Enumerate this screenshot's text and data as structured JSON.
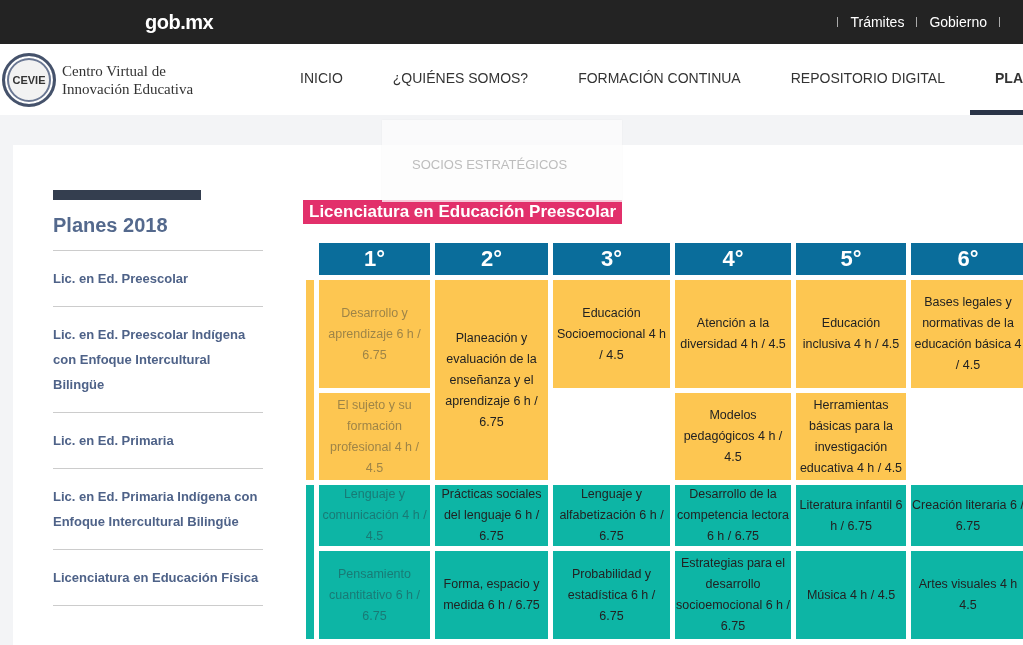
{
  "top_bar": {
    "brand": "gob.mx",
    "links": [
      "Trámites",
      "Gobierno"
    ]
  },
  "header": {
    "logo_badge": "CEVIE",
    "logo_lines": [
      "Centro Virtual de",
      "Innovación Educativa"
    ],
    "nav": [
      {
        "label": "INICIO",
        "selected": false
      },
      {
        "label": "¿QUIÉNES SOMOS?",
        "selected": false
      },
      {
        "label": "FORMACIÓN CONTINUA",
        "selected": false
      },
      {
        "label": "REPOSITORIO DIGITAL",
        "selected": false
      },
      {
        "label": "PLA",
        "selected": true
      }
    ],
    "dropdown": [
      "SOCIOS ESTRATÉGICOS"
    ]
  },
  "sidebar": {
    "title": "Planes 2018",
    "items": [
      "Lic. en Ed. Preescolar",
      "Lic. en Ed. Preescolar Indígena con Enfoque Intercultural Bilingüe",
      "Lic. en Ed. Primaria",
      "Lic. en Ed. Primaria Indígena con Enfoque Intercultural Bilingüe",
      "Licenciatura en Educación Física"
    ]
  },
  "plan": {
    "title": "Licenciatura en Educación Preescolar",
    "columns": [
      "1°",
      "2°",
      "3°",
      "4°",
      "5°",
      "6°"
    ],
    "groups": [
      {
        "color": "#fdc651",
        "rows": [
          [
            {
              "kind": "course",
              "text": "Desarrollo y aprendizaje 6 h / 6.75",
              "faded": true,
              "tall": false
            },
            {
              "kind": "course",
              "text": "Planeación y evaluación de la enseñanza y el aprendizaje 6 h / 6.75",
              "faded": false,
              "tall": true
            },
            {
              "kind": "course",
              "text": "Educación Socioemocional 4 h / 4.5",
              "faded": false,
              "tall": false
            },
            {
              "kind": "course",
              "text": "Atención a la diversidad 4 h / 4.5",
              "faded": false,
              "tall": false
            },
            {
              "kind": "course",
              "text": "Educación inclusiva 4 h / 4.5",
              "faded": false,
              "tall": false
            },
            {
              "kind": "course",
              "text": "Bases legales y normativas de la educación básica 4 / 4.5",
              "faded": false,
              "tall": false
            }
          ],
          [
            {
              "kind": "course",
              "text": "El sujeto y su formación profesional 4 h / 4.5",
              "faded": true,
              "tall": false
            },
            {
              "kind": "covered"
            },
            {
              "kind": "empty"
            },
            {
              "kind": "course",
              "text": "Modelos pedagógicos 4 h / 4.5",
              "faded": false,
              "tall": false
            },
            {
              "kind": "course",
              "text": "Herramientas básicas para la investigación educativa 4 h / 4.5",
              "faded": false,
              "tall": false
            },
            {
              "kind": "empty"
            }
          ]
        ]
      },
      {
        "color": "#0db5a5",
        "rows": [
          [
            {
              "kind": "course",
              "text": "Lenguaje y comunicación 4 h / 4.5",
              "faded": true,
              "tall": false
            },
            {
              "kind": "course",
              "text": "Prácticas sociales del lenguaje 6 h / 6.75",
              "faded": false,
              "tall": false
            },
            {
              "kind": "course",
              "text": "Lenguaje y alfabetización 6 h / 6.75",
              "faded": false,
              "tall": false
            },
            {
              "kind": "course",
              "text": "Desarrollo de la competencia lectora 6 h / 6.75",
              "faded": false,
              "tall": false
            },
            {
              "kind": "course",
              "text": "Literatura infantil 6 h / 6.75",
              "faded": false,
              "tall": false
            },
            {
              "kind": "course",
              "text": "Creación literaria 6 / 6.75",
              "faded": false,
              "tall": false
            }
          ],
          [
            {
              "kind": "course",
              "text": "Pensamiento cuantitativo 6 h / 6.75",
              "faded": true,
              "tall": false
            },
            {
              "kind": "course",
              "text": "Forma, espacio y medida 6 h / 6.75",
              "faded": false,
              "tall": false
            },
            {
              "kind": "course",
              "text": "Probabilidad y estadística 6 h / 6.75",
              "faded": false,
              "tall": false
            },
            {
              "kind": "course",
              "text": "Estrategias para el desarrollo socioemocional 6 h / 6.75",
              "faded": false,
              "tall": false
            },
            {
              "kind": "course",
              "text": "Música 4 h / 4.5",
              "faded": false,
              "tall": false
            },
            {
              "kind": "course",
              "text": "Artes visuales 4 h 4.5",
              "faded": false,
              "tall": false
            }
          ]
        ]
      }
    ]
  }
}
